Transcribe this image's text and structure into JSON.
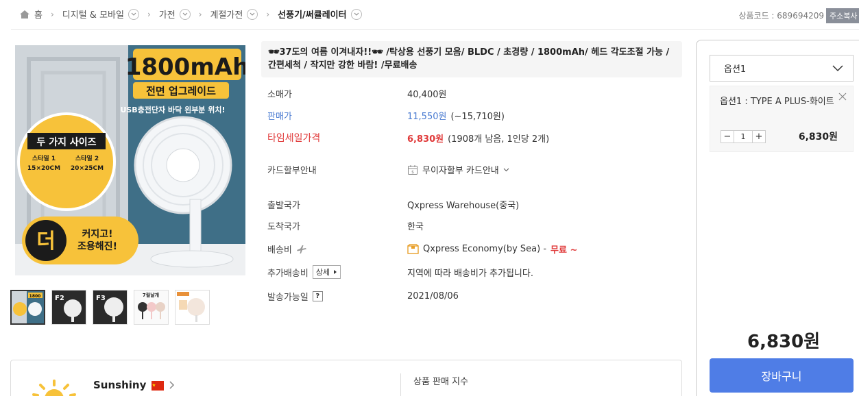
{
  "breadcrumb": {
    "home": "홈",
    "items": [
      {
        "label": "디지털 & 모바일"
      },
      {
        "label": "가전"
      },
      {
        "label": "계절가전"
      },
      {
        "label": "선풍기/써큘레이터"
      }
    ]
  },
  "product_code": "상품코드 : 689694209",
  "copy_address": "주소복사",
  "title": "🕶37도의 여름 이겨내자!!🕶 /탁상용 선풍기 모음/ BLDC / 초경량 / 1800mAh/ 헤드 각도조절 가능 / 간편세척 / 작지만 강한 바람! /무료배송",
  "main_image": {
    "headline": "1800mAh",
    "badge": "전면 업그레이드",
    "subline": "USB충전단자 바닥 왼부분 위치!",
    "sizes_title": "두 가지 사이즈",
    "size1_name": "스타일 1",
    "size1_dim": "15×20CM",
    "size2_name": "스타일 2",
    "size2_dim": "20×25CM",
    "round_text": "더",
    "bottom_text1": "커지고!",
    "bottom_text2": "조용해진!"
  },
  "thumbnails": [
    {
      "name": "thumb-1",
      "label": "1800"
    },
    {
      "name": "thumb-2",
      "label": "F2"
    },
    {
      "name": "thumb-3",
      "label": "F3"
    },
    {
      "name": "thumb-4",
      "label": "7컬날개"
    },
    {
      "name": "thumb-5",
      "label": ""
    }
  ],
  "info": {
    "retail_label": "소매가",
    "retail_value": "40,400원",
    "sale_label": "판매가",
    "sale_value": "11,550원",
    "sale_extra": "(~15,710원)",
    "timesale_label": "타임세일가격",
    "timesale_value": "6,830원",
    "timesale_extra": "(1908개 남음, 1인당 2개)",
    "card_label": "카드할부안내",
    "card_value": "무이자할부 카드안내",
    "origin_label": "출발국가",
    "origin_value": "Qxpress Warehouse(중국)",
    "dest_label": "도착국가",
    "dest_value": "한국",
    "ship_label": "배송비",
    "ship_value": "Qxpress Economy(by Sea) -",
    "ship_free": "무료 ~",
    "extra_ship_label": "추가배송비",
    "extra_ship_btn": "상세",
    "extra_ship_value": "지역에 따라 배송비가 추가됩니다.",
    "ship_date_label": "발송가능일",
    "ship_date_help": "?",
    "ship_date_value": "2021/08/06"
  },
  "options": {
    "select_label": "옵션1",
    "selected_option": "옵션1 : TYPE A PLUS-화이트",
    "qty": "1",
    "qty_minus": "−",
    "qty_plus": "+",
    "option_price": "6,830원",
    "total": "6,830원",
    "cart_button": "장바구니"
  },
  "seller": {
    "name": "Sunshiny",
    "sales_index_label": "상품 판매 지수"
  },
  "colors": {
    "accent_blue": "#4f7de6",
    "sale_red": "#e03a3a",
    "link_blue": "#4a7bd1",
    "image_yellow": "#f7c23a",
    "image_teal": "#3f6f87"
  }
}
